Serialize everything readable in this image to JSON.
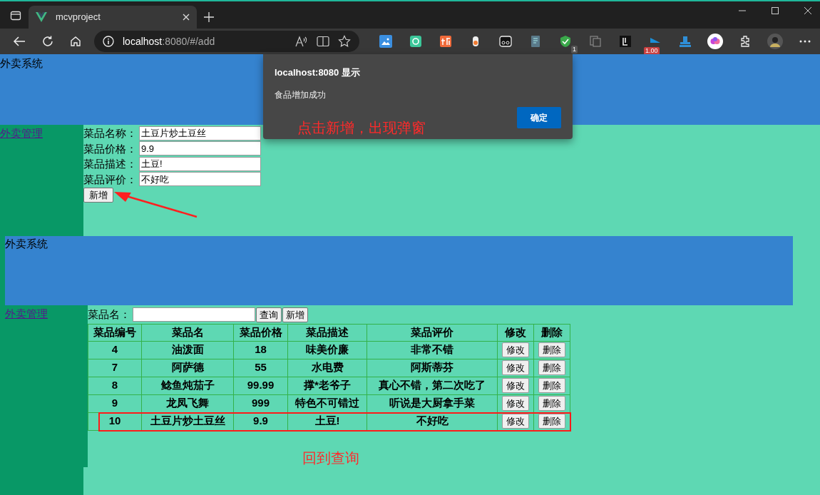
{
  "browser": {
    "tab_title": "mcvproject",
    "url_host": "localhost",
    "url_rest": ":8080/#/add",
    "extension_badges": [
      "1",
      "1.00"
    ]
  },
  "page": {
    "header_title": "外卖系统",
    "sidebar_link": "外卖管理",
    "form_fields": [
      {
        "label": "菜品名称：",
        "value": "土豆片炒土豆丝"
      },
      {
        "label": "菜品价格：",
        "value": "9.9"
      },
      {
        "label": "菜品描述：",
        "value": "土豆!"
      },
      {
        "label": "菜品评价：",
        "value": "不好吃"
      }
    ],
    "add_button": "新增"
  },
  "query_page": {
    "header_title": "外卖系统",
    "sidebar_link": "外卖管理",
    "search_label": "菜品名：",
    "query_button": "查询",
    "add_button": "新增",
    "columns": [
      "菜品编号",
      "菜品名",
      "菜品价格",
      "菜品描述",
      "菜品评价",
      "修改",
      "删除"
    ],
    "rows": [
      {
        "cells": [
          "4",
          "油泼面",
          "18",
          "味美价廉",
          "非常不错"
        ],
        "edit": "修改",
        "delete": "删除",
        "highlighted": false
      },
      {
        "cells": [
          "7",
          "阿萨德",
          "55",
          "水电费",
          "阿斯蒂芬"
        ],
        "edit": "修改",
        "delete": "删除",
        "highlighted": false
      },
      {
        "cells": [
          "8",
          "鲶鱼炖茄子",
          "99.99",
          "撑*老爷子",
          "真心不错，第二次吃了"
        ],
        "edit": "修改",
        "delete": "删除",
        "highlighted": false
      },
      {
        "cells": [
          "9",
          "龙凤飞舞",
          "999",
          "特色不可错过",
          "听说是大厨拿手菜"
        ],
        "edit": "修改",
        "delete": "删除",
        "highlighted": false
      },
      {
        "cells": [
          "10",
          "土豆片炒土豆丝",
          "9.9",
          "土豆!",
          "不好吃"
        ],
        "edit": "修改",
        "delete": "删除",
        "highlighted": true
      }
    ]
  },
  "dialog": {
    "title": "localhost:8080 显示",
    "message": "食品增加成功",
    "ok_button": "确定"
  },
  "annotations": [
    {
      "text": "点击新增，出现弹窗"
    },
    {
      "text": "回到查询"
    }
  ]
}
